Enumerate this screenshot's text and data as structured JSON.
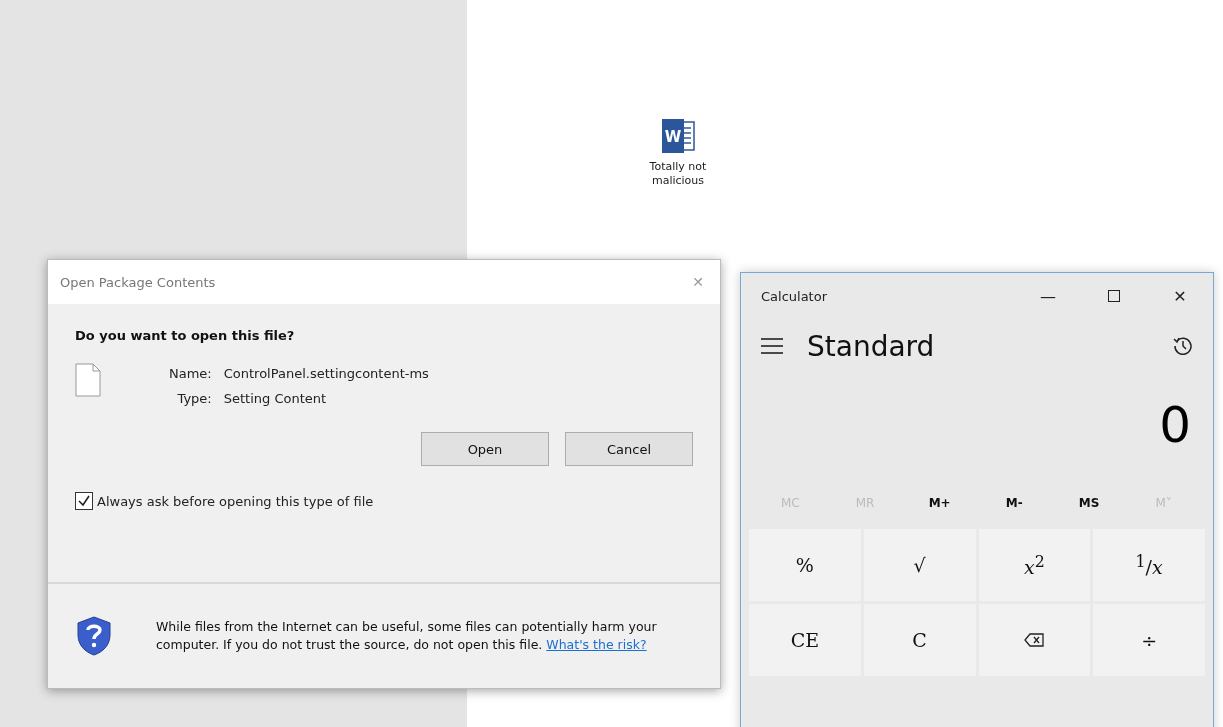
{
  "desktop_icon": {
    "logo_letter": "W",
    "label": "Totally not malicious"
  },
  "dialog": {
    "title": "Open Package Contents",
    "close": "✕",
    "question": "Do you want to open this file?",
    "fields": [
      {
        "label": "Name:",
        "value": "ControlPanel.settingcontent-ms"
      },
      {
        "label": "Type:",
        "value": "Setting Content"
      }
    ],
    "buttons": [
      "Open",
      "Cancel"
    ],
    "checkbox": {
      "label": "Always ask before opening this type of file",
      "checked": true
    },
    "warning": "While files from the Internet can be useful, some files can potentially harm your computer. If you do not trust the source, do not open this file.",
    "link": "What's the risk?"
  },
  "calculator": {
    "title": "Calculator",
    "minimize": "—",
    "close": "✕",
    "mode": "Standard",
    "display": "0",
    "memory": [
      {
        "label": "MC",
        "disabled": true
      },
      {
        "label": "MR",
        "disabled": true
      },
      {
        "label": "M+",
        "disabled": false
      },
      {
        "label": "M-",
        "disabled": false
      },
      {
        "label": "MS",
        "disabled": false
      },
      {
        "label": "M˅",
        "disabled": true
      }
    ],
    "keys": [
      {
        "kind": "text",
        "label": "%"
      },
      {
        "kind": "text",
        "label": "√"
      },
      {
        "kind": "text",
        "label": "*x*$^{2}$"
      },
      {
        "kind": "text",
        "label": "$^{1}$/*x*"
      },
      {
        "kind": "text",
        "label": "CE"
      },
      {
        "kind": "text",
        "label": "C"
      },
      {
        "kind": "backspace"
      },
      {
        "kind": "text",
        "label": "÷"
      }
    ]
  }
}
